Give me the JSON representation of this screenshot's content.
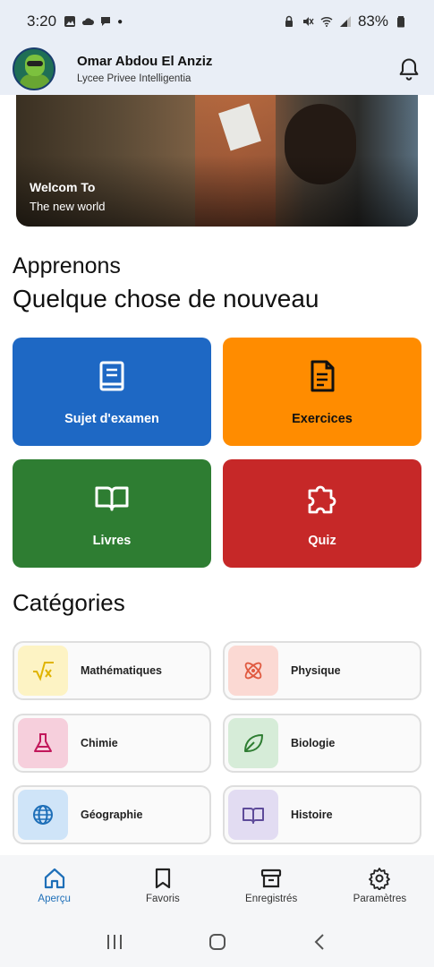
{
  "status_bar": {
    "time": "3:20",
    "battery": "83%"
  },
  "header": {
    "user_name": "Omar Abdou El Anziz",
    "school": "Lycee Privee Intelligentia"
  },
  "hero": {
    "title": "Welcom To",
    "subtitle": "The new world"
  },
  "intro": {
    "line1": "Apprenons",
    "line2": "Quelque chose de nouveau"
  },
  "tiles": [
    {
      "label": "Sujet d'examen",
      "icon": "book-icon",
      "color": "#1e68c4"
    },
    {
      "label": "Exercices",
      "icon": "document-icon",
      "color": "#ff8c00"
    },
    {
      "label": "Livres",
      "icon": "open-book-icon",
      "color": "#2e7d32"
    },
    {
      "label": "Quiz",
      "icon": "puzzle-icon",
      "color": "#c62828"
    }
  ],
  "categories": {
    "title": "Catégories",
    "items": [
      {
        "label": "Mathématiques",
        "icon": "sqrt-icon",
        "bg": "#fdf3c4",
        "fg": "#e0b400"
      },
      {
        "label": "Physique",
        "icon": "atom-icon",
        "bg": "#fbd9d3",
        "fg": "#e05a40"
      },
      {
        "label": "Chimie",
        "icon": "flask-icon",
        "bg": "#f6cfdc",
        "fg": "#c2185b"
      },
      {
        "label": "Biologie",
        "icon": "leaf-icon",
        "bg": "#d6ecd8",
        "fg": "#2e7d32"
      },
      {
        "label": "Géographie",
        "icon": "globe-icon",
        "bg": "#cfe4f8",
        "fg": "#1e6fb8"
      },
      {
        "label": "Histoire",
        "icon": "open-book-icon",
        "bg": "#e2dcf2",
        "fg": "#5e4b9a"
      }
    ]
  },
  "bottom_nav": [
    {
      "label": "Aperçu",
      "icon": "home-icon",
      "active": true
    },
    {
      "label": "Favoris",
      "icon": "bookmark-icon",
      "active": false
    },
    {
      "label": "Enregistrés",
      "icon": "archive-icon",
      "active": false
    },
    {
      "label": "Paramètres",
      "icon": "gear-icon",
      "active": false
    }
  ]
}
